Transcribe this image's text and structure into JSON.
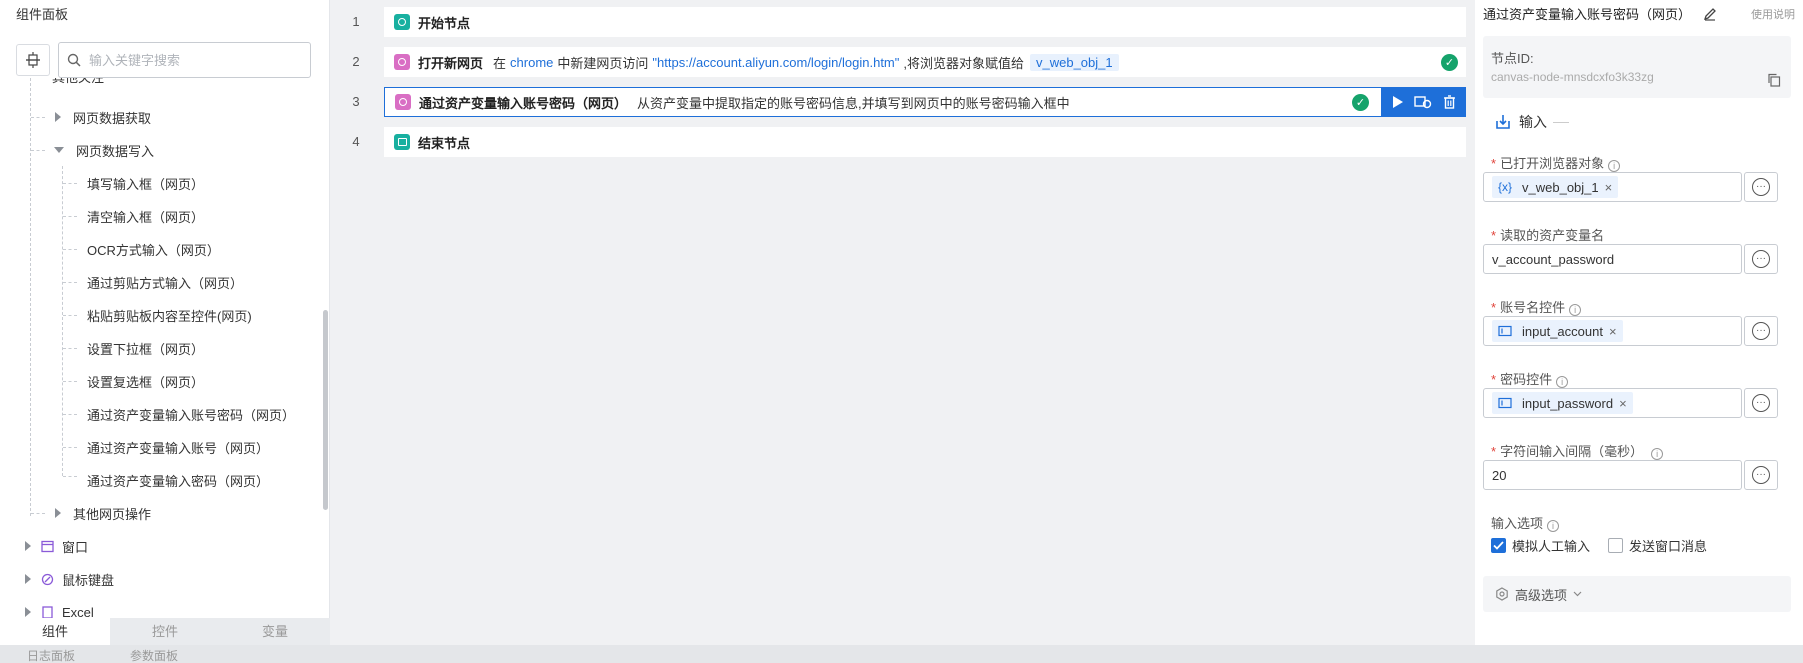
{
  "left_panel": {
    "title": "组件面板",
    "search_placeholder": "输入关键字搜索",
    "tree": {
      "partial_top": "其他关注",
      "web_data_get": "网页数据获取",
      "web_data_write": "网页数据写入",
      "items": [
        "填写输入框（网页）",
        "清空输入框（网页）",
        "OCR方式输入（网页）",
        "通过剪贴方式输入（网页）",
        "粘贴剪贴板内容至控件(网页)",
        "设置下拉框（网页）",
        "设置复选框（网页）",
        "通过资产变量输入账号密码（网页）",
        "通过资产变量输入账号（网页）",
        "通过资产变量输入密码（网页）"
      ],
      "other_web_ops": "其他网页操作",
      "window": "窗口",
      "mouse_keyboard": "鼠标键盘",
      "excel": "Excel"
    },
    "tabs": [
      "组件",
      "控件",
      "变量"
    ]
  },
  "bottom_bar": {
    "log_panel": "日志面板",
    "param_panel": "参数面板"
  },
  "flow": {
    "rows": [
      {
        "num": "1",
        "title": "开始节点"
      },
      {
        "num": "2",
        "title": "打开新网页",
        "desc_pre": "在",
        "browser": "chrome",
        "desc_mid": "中新建网页访问",
        "url": "\"https://account.aliyun.com/login/login.htm\"",
        "desc_post": ",将浏览器对象赋值给",
        "var": "v_web_obj_1"
      },
      {
        "num": "3",
        "title": "通过资产变量输入账号密码（网页）",
        "desc": "从资产变量中提取指定的账号密码信息,并填写到网页中的账号密码输入框中"
      },
      {
        "num": "4",
        "title": "结束节点"
      }
    ]
  },
  "right_panel": {
    "title": "通过资产变量输入账号密码（网页）",
    "help": "使用说明",
    "node_id_label": "节点ID:",
    "node_id": "canvas-node-mnsdcxfo3k33zg",
    "input_section": "输入",
    "fields": {
      "browser_obj": {
        "label": "已打开浏览器对象",
        "var_icon": "{x}",
        "value": "v_web_obj_1"
      },
      "asset_var": {
        "label": "读取的资产变量名",
        "value": "v_account_password"
      },
      "account_ctrl": {
        "label": "账号名控件",
        "value": "input_account"
      },
      "password_ctrl": {
        "label": "密码控件",
        "value": "input_password"
      },
      "interval": {
        "label": "字符间输入间隔（毫秒）",
        "value": "20"
      }
    },
    "input_options_label": "输入选项",
    "opt_simulate": "模拟人工输入",
    "opt_send_msg": "发送窗口消息",
    "advanced": "高级选项"
  },
  "colors": {
    "accent": "#1e6fd9",
    "success": "#15a36b",
    "required": "#e0443b"
  }
}
